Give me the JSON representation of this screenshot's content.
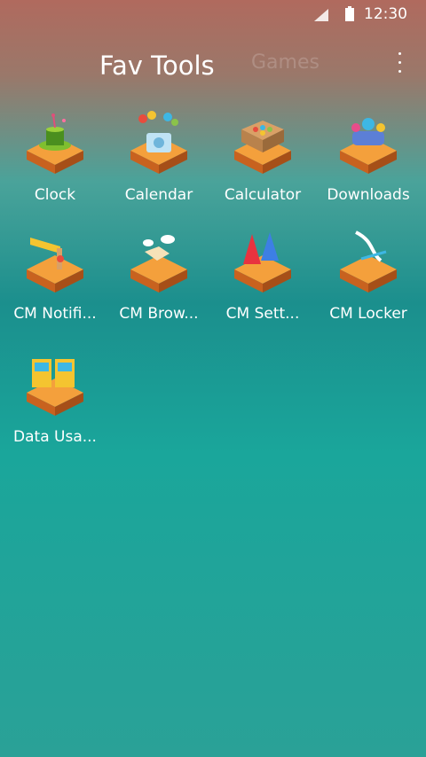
{
  "status_bar": {
    "time": "12:30",
    "icons": [
      "signal-icon",
      "battery-icon"
    ]
  },
  "tabs": [
    {
      "label": "Fav Tools",
      "active": true
    },
    {
      "label": "Games",
      "active": false
    }
  ],
  "menu": {
    "icon": "overflow-menu-icon"
  },
  "apps": [
    {
      "label": "Clock",
      "icon": "magic-hat-icon"
    },
    {
      "label": "Calendar",
      "icon": "camera-balloons-icon"
    },
    {
      "label": "Calculator",
      "icon": "candy-box-icon"
    },
    {
      "label": "Downloads",
      "icon": "candy-bag-icon"
    },
    {
      "label": "CM Notifi...",
      "icon": "horn-icon"
    },
    {
      "label": "CM Brow...",
      "icon": "winged-box-icon"
    },
    {
      "label": "CM Sett...",
      "icon": "party-hats-icon"
    },
    {
      "label": "CM Locker",
      "icon": "ribbon-icon"
    },
    {
      "label": "Data Usa...",
      "icon": "arcade-icon"
    }
  ],
  "colors": {
    "platform_top": "#f4a03c",
    "platform_side": "#c8621f",
    "text": "#ffffff"
  }
}
